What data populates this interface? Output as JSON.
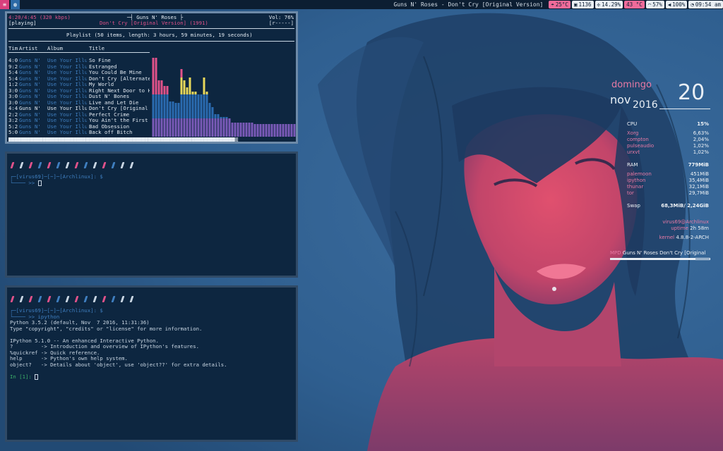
{
  "topbar": {
    "menu_icon": "menu-icon",
    "globe_icon": "globe-icon",
    "window_title": "Guns N' Roses - Don't Cry [Original Version]",
    "weather": "25°C",
    "updates": "1136",
    "cpu": "14.29%",
    "temp": "43 °C",
    "wifi": "57%",
    "volume": "100%",
    "clock": "09:54 am",
    "colors": {
      "accent": "#f06b9a",
      "bar": "#0c1e32"
    }
  },
  "ncmpcpp": {
    "time": "4:20/4:45 (320 kbps)",
    "status": "[playing]",
    "artist_box": "Guns N' Roses",
    "song_line": "Don't Cry [Original Version] (1991)",
    "volume": "Vol: 76%",
    "flags": "[r-----]",
    "playlist_info": "Playlist (50 items, length: 3 hours, 59 minutes, 19 seconds)",
    "columns": {
      "time": "Tim",
      "artist": "Artist",
      "album": "Album",
      "title": "Title"
    },
    "rows": [
      {
        "time": "4:0",
        "artist": "Guns N'",
        "album": "Use Your Illu",
        "title": "So Fine"
      },
      {
        "time": "9:2",
        "artist": "Guns N'",
        "album": "Use Your Illu",
        "title": "Estranged"
      },
      {
        "time": "5:4",
        "artist": "Guns N'",
        "album": "Use Your Illu",
        "title": "You Could Be Mine"
      },
      {
        "time": "5:4",
        "artist": "Guns N'",
        "album": "Use Your Illu",
        "title": "Don't Cry [Alternate"
      },
      {
        "time": "1:2",
        "artist": "Guns N'",
        "album": "Use Your Illu",
        "title": "My World"
      },
      {
        "time": "3:0",
        "artist": "Guns N'",
        "album": "Use Your Illu",
        "title": "Right Next Door to H"
      },
      {
        "time": "3:0",
        "artist": "Guns N'",
        "album": "Use Your Illu",
        "title": "Dust N' Bones"
      },
      {
        "time": "3:0",
        "artist": "Guns N'",
        "album": "Use Your Illu",
        "title": "Live and Let Die"
      },
      {
        "time": "4:4",
        "artist": "Guns N'",
        "album": "Use Your Illu",
        "title": "Don't Cry [Original"
      },
      {
        "time": "2:2",
        "artist": "Guns N'",
        "album": "Use Your Illu",
        "title": "Perfect Crime"
      },
      {
        "time": "3:2",
        "artist": "Guns N'",
        "album": "Use Your Illu",
        "title": "You Ain't the First"
      },
      {
        "time": "5:2",
        "artist": "Guns N'",
        "album": "Use Your Illu",
        "title": "Bad Obsession"
      },
      {
        "time": "5:0",
        "artist": "Guns N'",
        "album": "Use Your Illu",
        "title": "Back off Bitch"
      }
    ],
    "active_row": 8,
    "progress": "█████████████████████████████████████████████████████████████████████████▒"
  },
  "terminal1": {
    "prompt_line1": "┌─[virus69]─[~]─[Archlinux]: $",
    "prompt_line2": "└──── >>"
  },
  "terminal2": {
    "prompt_line1": "┌─[virus69]─[~]─[Archlinux]: $",
    "prompt_line2": "└──── >>  ipython",
    "lines": [
      "Python 3.5.2 (default, Nov  7 2016, 11:31:36)",
      "Type \"copyright\", \"credits\" or \"license\" for more information.",
      "",
      "IPython 5.1.0 -- An enhanced Interactive Python.",
      "?         -> Introduction and overview of IPython's features.",
      "%quickref -> Quick reference.",
      "help      -> Python's own help system.",
      "object?   -> Details about 'object', use 'object??' for extra details."
    ],
    "in_prompt": "In [1]:"
  },
  "workspace_colors": [
    "#e0528a",
    "#c9d6e3",
    "#e0528a",
    "#3f7fc0",
    "#e0528a",
    "#3f7fc0",
    "#c9d6e3",
    "#e0528a",
    "#3f7fc0",
    "#c9d6e3",
    "#e0528a",
    "#3f7fc0",
    "#c9d6e3",
    "#c9d6e3"
  ],
  "conky": {
    "day": "domingo",
    "month": "nov",
    "year": "2016",
    "date": "20",
    "cpu_label": "CPU",
    "cpu_value": "15%",
    "cpu_procs": [
      {
        "name": "Xorg",
        "value": "6,63%"
      },
      {
        "name": "compton",
        "value": "2,04%"
      },
      {
        "name": "pulseaudio",
        "value": "1,02%"
      },
      {
        "name": "urxvt",
        "value": "1,02%"
      }
    ],
    "ram_label": "RAM",
    "ram_value": "779MiB",
    "ram_procs": [
      {
        "name": "palemoon",
        "value": "451MiB"
      },
      {
        "name": "ipython",
        "value": "35,4MiB"
      },
      {
        "name": "thunar",
        "value": "32,1MiB"
      },
      {
        "name": "tor",
        "value": "29,7MiB"
      }
    ],
    "swap_label": "Swap",
    "swap_value": "68,3MiB/ 2,24GiB",
    "user": "virus69@Archlinux",
    "uptime_label": "uptime",
    "uptime_value": "2h 58m",
    "kernel_label": "kernel",
    "kernel_value": "4.8.8-2-ARCH",
    "mpd_label": "MPD",
    "mpd_value": "Guns N' Roses Don't Cry [Original",
    "mpd_progress": 0.86
  },
  "visualizer": [
    {
      "h": 112,
      "c": "m"
    },
    {
      "h": 112,
      "c": "m"
    },
    {
      "h": 80,
      "c": "m"
    },
    {
      "h": 80,
      "c": "m"
    },
    {
      "h": 72,
      "c": "m"
    },
    {
      "h": 72,
      "c": "m"
    },
    {
      "h": 50,
      "c": "b"
    },
    {
      "h": 50,
      "c": "b"
    },
    {
      "h": 48,
      "c": "b"
    },
    {
      "h": 48,
      "c": "b"
    },
    {
      "h": 96,
      "c": "y"
    },
    {
      "h": 80,
      "c": "y"
    },
    {
      "h": 70,
      "c": "y"
    },
    {
      "h": 84,
      "c": "y"
    },
    {
      "h": 64,
      "c": "y"
    },
    {
      "h": 64,
      "c": "y"
    },
    {
      "h": 60,
      "c": "y"
    },
    {
      "h": 60,
      "c": "y"
    },
    {
      "h": 84,
      "c": "y"
    },
    {
      "h": 64,
      "c": "y"
    },
    {
      "h": 48,
      "c": "b"
    },
    {
      "h": 42,
      "c": "b"
    },
    {
      "h": 32,
      "c": "b"
    },
    {
      "h": 32,
      "c": "b"
    },
    {
      "h": 28,
      "c": "b"
    },
    {
      "h": 28,
      "c": "b"
    },
    {
      "h": 28,
      "c": "b"
    },
    {
      "h": 26,
      "c": "b"
    },
    {
      "h": 20,
      "c": "b"
    },
    {
      "h": 20,
      "c": "b"
    },
    {
      "h": 20,
      "c": "b"
    },
    {
      "h": 20,
      "c": "b"
    },
    {
      "h": 20,
      "c": "b"
    },
    {
      "h": 20,
      "c": "b"
    },
    {
      "h": 20,
      "c": "b"
    },
    {
      "h": 20,
      "c": "b"
    },
    {
      "h": 18,
      "c": "b"
    },
    {
      "h": 18,
      "c": "b"
    },
    {
      "h": 18,
      "c": "b"
    },
    {
      "h": 18,
      "c": "b"
    },
    {
      "h": 18,
      "c": "b"
    },
    {
      "h": 18,
      "c": "b"
    },
    {
      "h": 18,
      "c": "b"
    },
    {
      "h": 18,
      "c": "b"
    },
    {
      "h": 18,
      "c": "b"
    },
    {
      "h": 18,
      "c": "b"
    },
    {
      "h": 18,
      "c": "b"
    },
    {
      "h": 18,
      "c": "b"
    },
    {
      "h": 18,
      "c": "b"
    },
    {
      "h": 18,
      "c": "b"
    },
    {
      "h": 18,
      "c": "b"
    }
  ]
}
